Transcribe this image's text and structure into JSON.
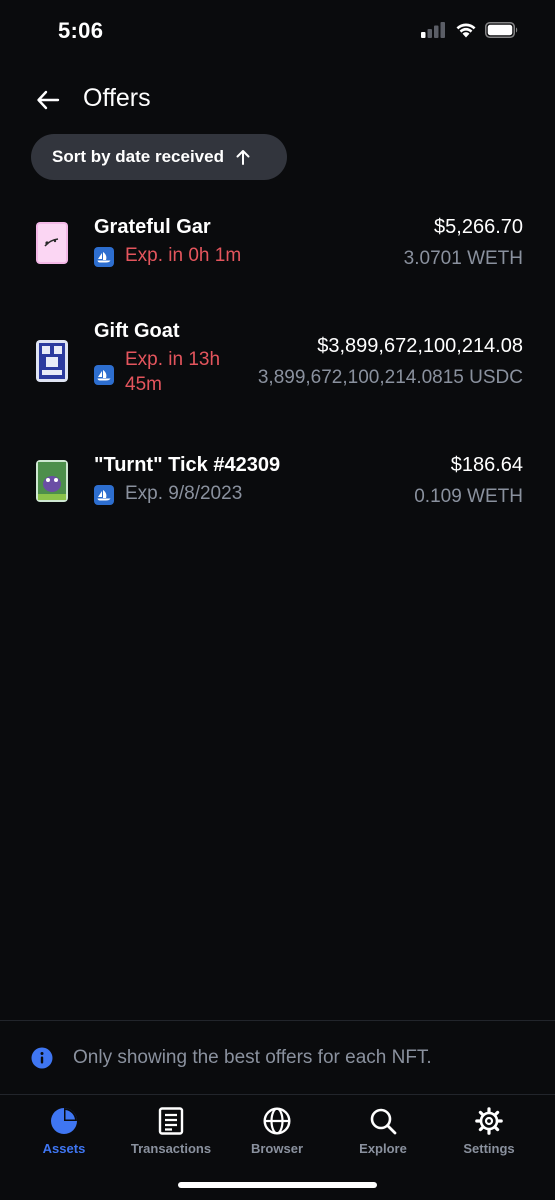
{
  "status_bar": {
    "time": "5:06"
  },
  "header": {
    "title": "Offers",
    "back_icon": "arrow-left-icon"
  },
  "sort": {
    "label": "Sort by date received",
    "direction_icon": "arrow-up-icon"
  },
  "offers": [
    {
      "name": "Grateful Gar",
      "expiry": "Exp. in 0h 1m",
      "expiry_line2": "",
      "expiry_urgent": true,
      "price_usd": "$5,266.70",
      "amount": "3.0701 WETH",
      "marketplace_icon": "opensea-icon"
    },
    {
      "name": "Gift Goat",
      "expiry": "Exp. in 13h",
      "expiry_line2": "45m",
      "expiry_urgent": true,
      "price_usd": "$3,899,672,100,214.08",
      "amount": "3,899,672,100,214.0815 USDC",
      "marketplace_icon": "opensea-icon"
    },
    {
      "name": "\"Turnt\" Tick #42309",
      "expiry": "Exp. 9/8/2023",
      "expiry_line2": "",
      "expiry_urgent": false,
      "price_usd": "$186.64",
      "amount": "0.109 WETH",
      "marketplace_icon": "opensea-icon"
    }
  ],
  "info_banner": {
    "text": "Only showing the best offers for each NFT.",
    "icon": "info-icon"
  },
  "tabs": [
    {
      "label": "Assets",
      "icon": "pie-chart-icon",
      "active": true
    },
    {
      "label": "Transactions",
      "icon": "document-icon",
      "active": false
    },
    {
      "label": "Browser",
      "icon": "globe-icon",
      "active": false
    },
    {
      "label": "Explore",
      "icon": "search-icon",
      "active": false
    },
    {
      "label": "Settings",
      "icon": "gear-icon",
      "active": false
    }
  ],
  "colors": {
    "background": "#0a0b0d",
    "accent": "#3f76f2",
    "urgent": "#e4555d",
    "muted": "#8a919e",
    "pill": "#32353d",
    "opensea": "#2d6ecf"
  }
}
